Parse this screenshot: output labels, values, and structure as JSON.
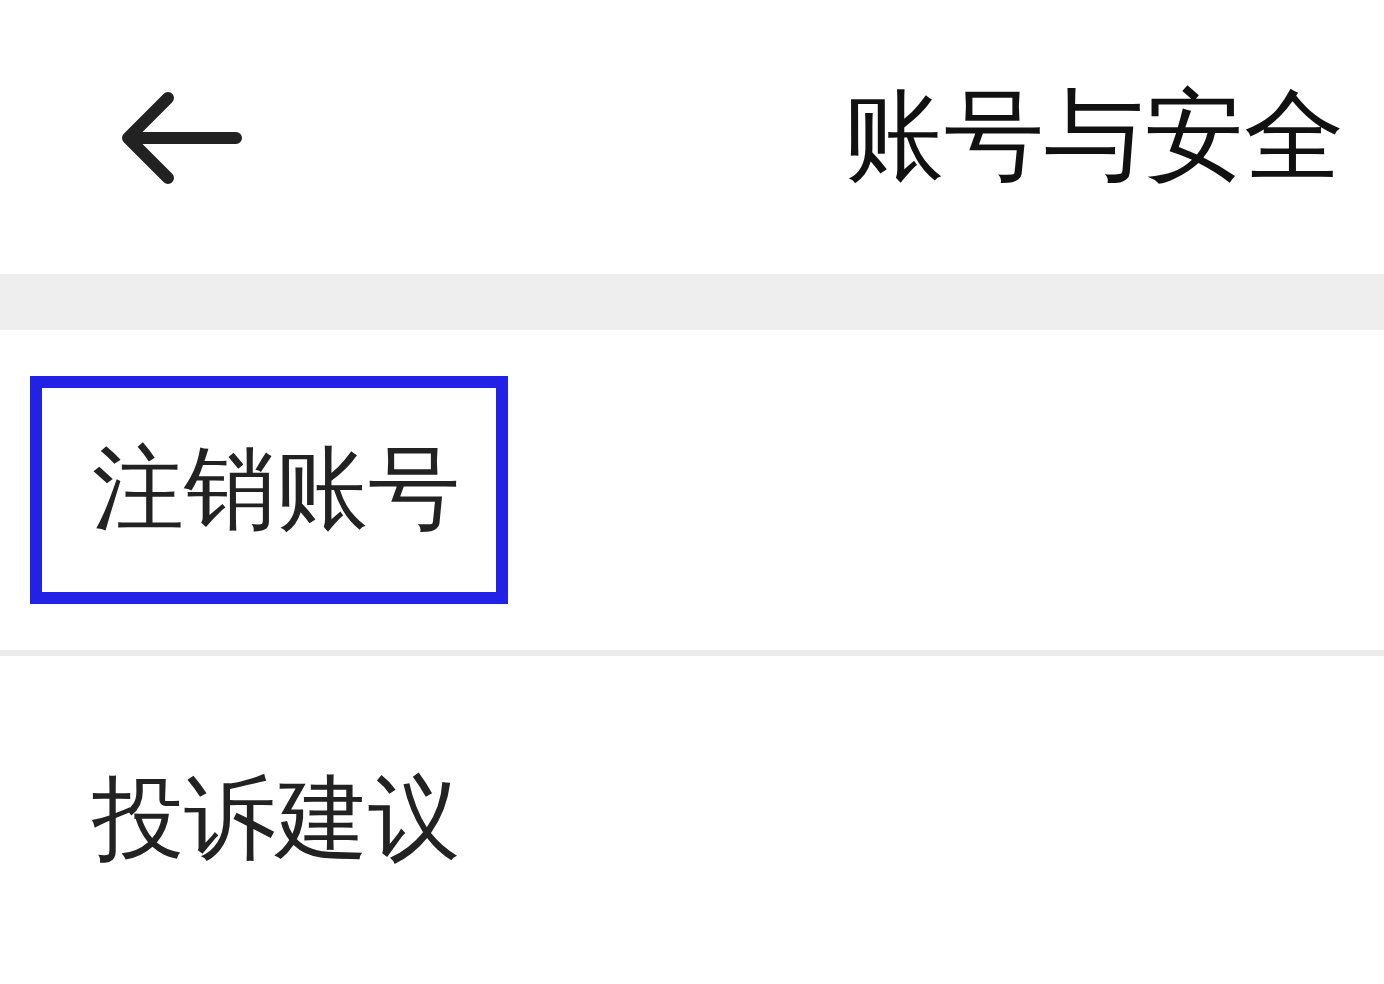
{
  "header": {
    "title": "账号与安全"
  },
  "items": [
    {
      "label": "注销账号",
      "highlighted": true
    },
    {
      "label": "投诉建议",
      "highlighted": false
    }
  ]
}
